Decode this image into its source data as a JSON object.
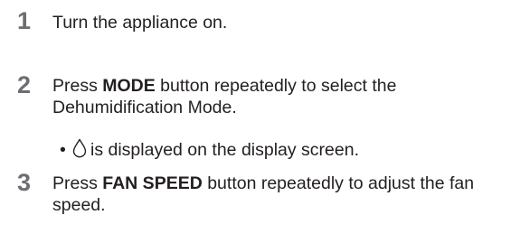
{
  "steps": [
    {
      "number": "1",
      "text": "Turn the appliance on."
    },
    {
      "number": "2",
      "prefix": "Press ",
      "keyword": "MODE",
      "suffix": " button repeatedly to select the Dehumidification Mode.",
      "bullet": {
        "marker": "•",
        "icon": "water-drop-icon",
        "text": "is displayed on the display screen."
      }
    },
    {
      "number": "3",
      "prefix": "Press ",
      "keyword": "FAN SPEED",
      "suffix": " button repeatedly to adjust the fan speed."
    }
  ]
}
